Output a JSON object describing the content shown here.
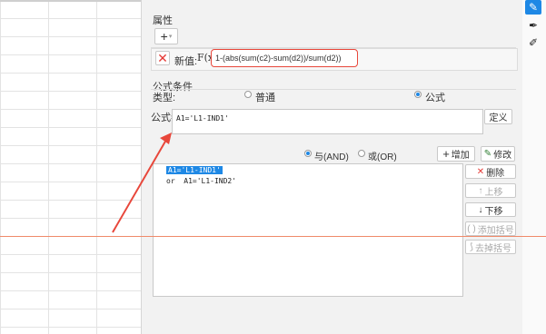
{
  "panel": {
    "properties_title": "属性",
    "add_label": "+",
    "new_value_label": "新值:",
    "fx_label": "F(x)",
    "formula_value": "1-(abs(sum(c2)-sum(d2))/sum(d2))",
    "condition_title": "公式条件",
    "type_label": "类型:",
    "type_options": {
      "normal": "普通",
      "formula": "公式"
    },
    "formula_eq_label": "公式=",
    "formula_expr": "A1='L1-IND1'",
    "define_button": "定义",
    "logic": {
      "and": "与(AND)",
      "or": "或(OR)"
    },
    "add_button": "增加",
    "modify_button": "修改",
    "conditions": [
      {
        "text": "A1='L1-IND1'"
      },
      {
        "text": "or  A1='L1-IND2'"
      }
    ],
    "side_buttons": {
      "delete": "删除",
      "up": "上移",
      "down": "下移",
      "add_bracket": "添加括号",
      "remove_bracket": "去掉括号"
    }
  },
  "colors": {
    "accent": "#1e88e5",
    "annotation": "#e8473b"
  }
}
